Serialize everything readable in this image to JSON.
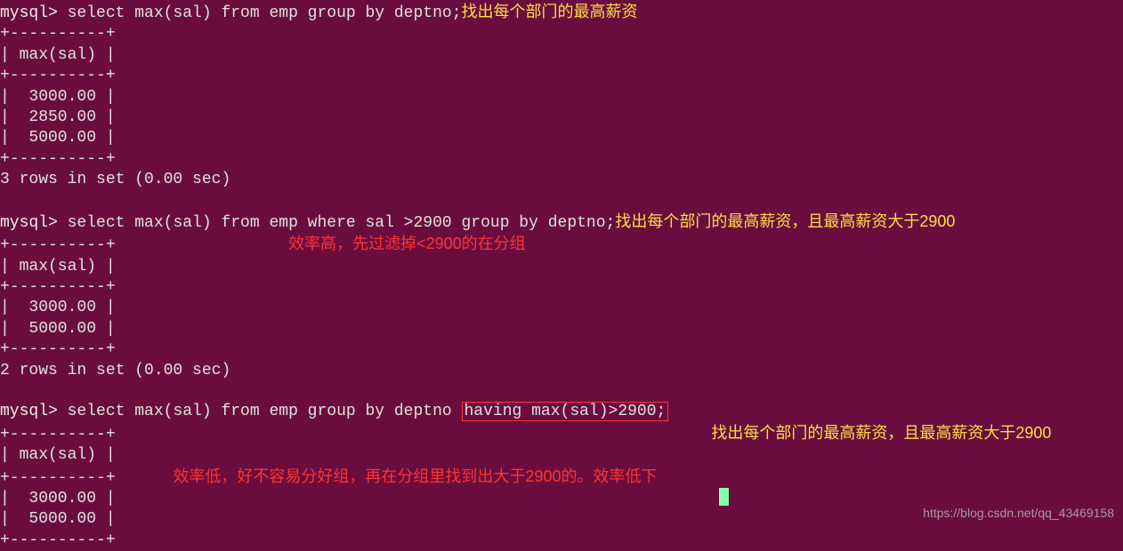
{
  "query1": {
    "prompt": "mysql> ",
    "sql": "select max(sal) from emp group by deptno;",
    "annotation": "找出每个部门的最高薪资",
    "divider": "+----------+",
    "header": "| max(sal) |",
    "rows": [
      "|  3000.00 |",
      "|  2850.00 |",
      "|  5000.00 |"
    ],
    "footer": "3 rows in set (0.00 sec)"
  },
  "query2": {
    "prompt": "mysql> ",
    "sql": "select max(sal) from emp where sal >2900 group by deptno;",
    "annotation": "找出每个部门的最高薪资，且最高薪资大于2900",
    "efficiency_note": "效率高，先过滤掉<2900的在分组",
    "divider": "+----------+",
    "header": "| max(sal) |",
    "rows": [
      "|  3000.00 |",
      "|  5000.00 |"
    ],
    "footer": "2 rows in set (0.00 sec)"
  },
  "query3": {
    "prompt": "mysql> ",
    "sql_part1": "select max(sal) from emp group by deptno ",
    "sql_boxed": "having max(sal)>2900;",
    "annotation": "找出每个部门的最高薪资，且最高薪资大于2900",
    "efficiency_note": "效率低，好不容易分好组，再在分组里找到出大于2900的。效率低下",
    "divider": "+----------+",
    "header": "| max(sal) |",
    "rows": [
      "|  3000.00 |",
      "|  5000.00 |"
    ]
  },
  "watermark": "https://blog.csdn.net/qq_43469158"
}
